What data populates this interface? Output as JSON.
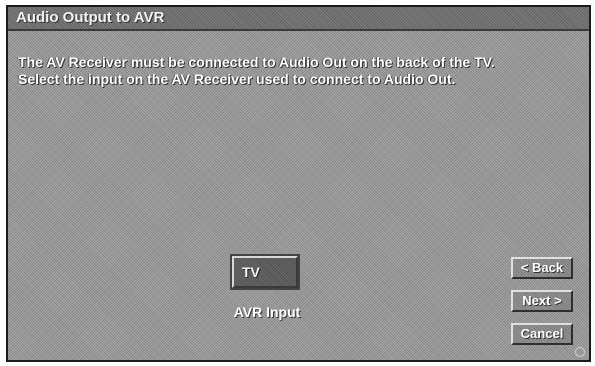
{
  "dialog": {
    "title": "Audio Output to AVR",
    "instructions": [
      "The AV Receiver must be connected to Audio Out on the back of the TV.",
      "Select the input on the AV Receiver used to connect to Audio Out."
    ]
  },
  "avr_input": {
    "value": "TV",
    "label": "AVR Input"
  },
  "buttons": {
    "back": "< Back",
    "next": "Next >",
    "cancel": "Cancel"
  },
  "colors": {
    "background": "#9c9c9c",
    "title_bar": "#6e6e6e",
    "text": "#ffffff"
  }
}
